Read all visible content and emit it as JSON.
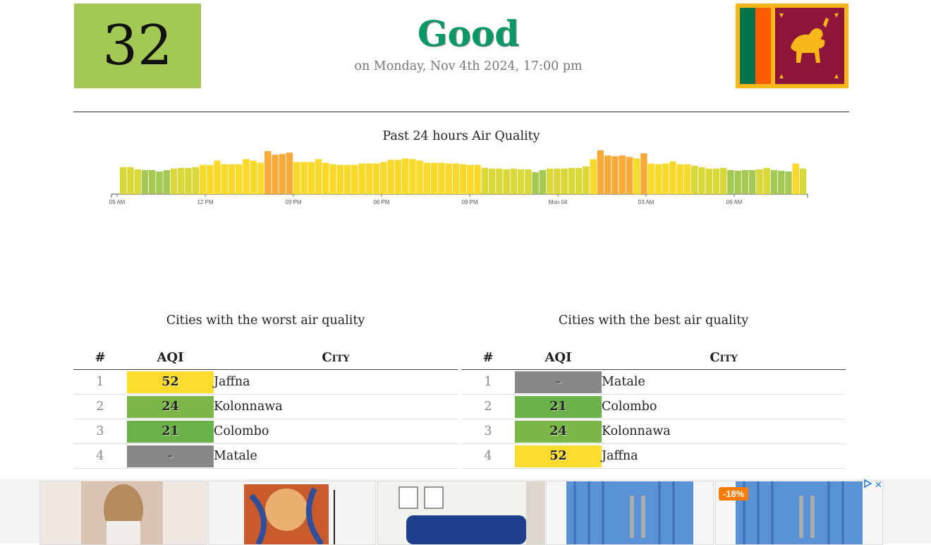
{
  "summary": {
    "aqi_value": "32",
    "aqi_color": "#a3c853",
    "status": "Good",
    "status_color": "#0a9964",
    "updated": "on Monday, Nov 4th 2024, 17:00 pm",
    "flag_icon": "sri-lanka-flag-icon"
  },
  "chart_data": {
    "type": "bar",
    "title": "Past 24 hours Air Quality",
    "tick_labels": [
      "09 AM",
      "12 PM",
      "03 PM",
      "06 PM",
      "09 PM",
      "Mon 04",
      "03 AM",
      "06 AM"
    ],
    "values": [
      37,
      37,
      34,
      33,
      33,
      31,
      33,
      35,
      36,
      36,
      37,
      40,
      40,
      46,
      41,
      41,
      41,
      48,
      46,
      43,
      59,
      54,
      55,
      57,
      44,
      44,
      44,
      48,
      43,
      41,
      40,
      40,
      40,
      42,
      42,
      42,
      44,
      47,
      47,
      49,
      48,
      46,
      43,
      43,
      43,
      42,
      42,
      41,
      40,
      40,
      36,
      35,
      35,
      34,
      35,
      34,
      34,
      30,
      33,
      35,
      35,
      35,
      36,
      36,
      38,
      48,
      60,
      53,
      52,
      53,
      51,
      49,
      56,
      42,
      41,
      42,
      45,
      41,
      41,
      39,
      37,
      35,
      35,
      36,
      33,
      32,
      33,
      33,
      34,
      36,
      33,
      32,
      31,
      42,
      35
    ],
    "colors": {
      "green": "#a3c853",
      "yellow": "#f9d92a",
      "orange": "#f7a93a"
    },
    "ylim": [
      0,
      60
    ]
  },
  "worst": {
    "title": "Cities with the worst air quality",
    "headers": {
      "num": "#",
      "aqi": "AQI",
      "city": "City"
    },
    "rows": [
      {
        "rank": "1",
        "aqi": "52",
        "city": "Jaffna",
        "color": "#fddc2e"
      },
      {
        "rank": "2",
        "aqi": "24",
        "city": "Kolonnawa",
        "color": "#7ab648"
      },
      {
        "rank": "3",
        "aqi": "21",
        "city": "Colombo",
        "color": "#6bb24a"
      },
      {
        "rank": "4",
        "aqi": "-",
        "city": "Matale",
        "color": "#888888"
      }
    ]
  },
  "best": {
    "title": "Cities with the best air quality",
    "headers": {
      "num": "#",
      "aqi": "AQI",
      "city": "City"
    },
    "rows": [
      {
        "rank": "1",
        "aqi": "-",
        "city": "Matale",
        "color": "#888888"
      },
      {
        "rank": "2",
        "aqi": "21",
        "city": "Colombo",
        "color": "#6bb24a"
      },
      {
        "rank": "3",
        "aqi": "24",
        "city": "Kolonnawa",
        "color": "#7ab648"
      },
      {
        "rank": "4",
        "aqi": "52",
        "city": "Jaffna",
        "color": "#fddc2e"
      }
    ]
  },
  "ads": {
    "discount_badge": "-18%",
    "close_label": "✕",
    "adchoices_icon": "adchoices-icon"
  }
}
